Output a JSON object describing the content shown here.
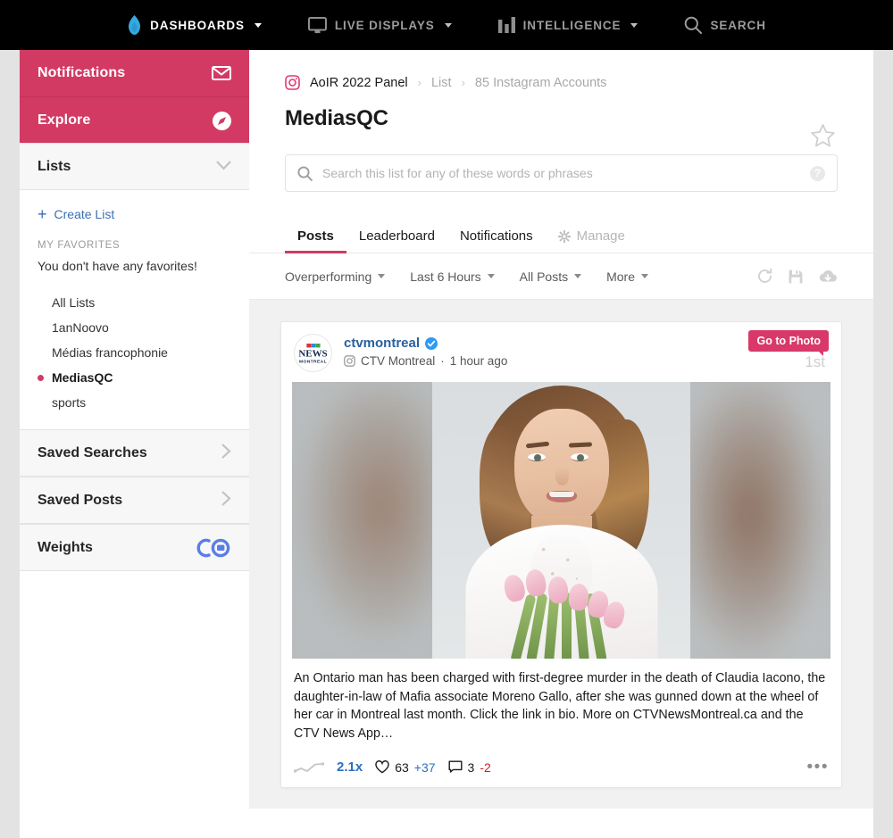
{
  "topnav": {
    "items": [
      {
        "label": "DASHBOARDS",
        "icon": "flame-icon",
        "caret": true,
        "active": true
      },
      {
        "label": "LIVE DISPLAYS",
        "icon": "monitor-icon",
        "caret": true,
        "active": false
      },
      {
        "label": "INTELLIGENCE",
        "icon": "bar-chart-icon",
        "caret": true,
        "active": false
      },
      {
        "label": "SEARCH",
        "icon": "search-icon",
        "caret": false,
        "active": false
      }
    ]
  },
  "sidebar": {
    "notifications_label": "Notifications",
    "notifications_icon": "envelope-icon",
    "explore_label": "Explore",
    "explore_icon": "compass-icon",
    "lists_label": "Lists",
    "lists_chevron": "chevron-down-icon",
    "create_list_label": "Create List",
    "favorites_header": "MY FAVORITES",
    "favorites_empty": "You don't have any favorites!",
    "lists": [
      {
        "label": "All Lists",
        "selected": false
      },
      {
        "label": "1anNoovo",
        "selected": false
      },
      {
        "label": "Médias francophonie",
        "selected": false
      },
      {
        "label": "MediasQC",
        "selected": true
      },
      {
        "label": "sports",
        "selected": false
      }
    ],
    "saved_searches_label": "Saved Searches",
    "saved_posts_label": "Saved Posts",
    "weights_label": "Weights",
    "weights_icon": "crowdtangle-co-icon"
  },
  "header": {
    "platform_icon": "instagram-icon",
    "breadcrumb": [
      {
        "label": "AoIR 2022 Panel",
        "muted": false
      },
      {
        "label": "List",
        "muted": true
      },
      {
        "label": "85 Instagram Accounts",
        "muted": true
      }
    ],
    "star_icon": "star-outline-icon",
    "title": "MediasQC"
  },
  "search": {
    "icon": "search-icon",
    "value": "",
    "placeholder": "Search this list for any of these words or phrases",
    "help_icon": "question-mark-icon",
    "help_label": "?"
  },
  "tabs": [
    {
      "label": "Posts",
      "active": true,
      "muted": false
    },
    {
      "label": "Leaderboard",
      "active": false,
      "muted": false
    },
    {
      "label": "Notifications",
      "active": false,
      "muted": false
    },
    {
      "label": "Manage",
      "active": false,
      "muted": true,
      "icon": "gear-icon"
    }
  ],
  "filters": {
    "items": [
      {
        "label": "Overperforming"
      },
      {
        "label": "Last 6 Hours"
      },
      {
        "label": "All Posts"
      },
      {
        "label": "More"
      }
    ],
    "tools": [
      {
        "name": "refresh-icon"
      },
      {
        "name": "save-icon"
      },
      {
        "name": "download-cloud-icon"
      }
    ]
  },
  "post": {
    "avatar_name": "ctv-news-montreal-logo",
    "avatar_line1": "CTV",
    "avatar_line2": "NEWS",
    "avatar_line3": "MONTREAL",
    "handle": "ctvmontreal",
    "verified_icon": "verified-badge-icon",
    "source_icon": "instagram-icon",
    "source": "CTV Montreal",
    "separator": "·",
    "time": "1 hour ago",
    "goto_label": "Go to Photo",
    "rank": "1st",
    "image_alt": "Woman in white lace dress holding pink tulips",
    "text": "An Ontario man has been charged with first-degree murder in the death of Claudia Iacono, the daughter-in-law of Mafia associate Moreno Gallo, after she was gunned down at the wheel of her car in Montreal last month. Click the link in bio. More on CTVNewsMontreal.ca and the CTV News App…",
    "metrics": {
      "sparkline_icon": "sparkline-icon",
      "overperforming": "2.1x",
      "like_icon": "heart-icon",
      "likes": "63",
      "likes_delta": "+37",
      "comment_icon": "comment-icon",
      "comments": "3",
      "comments_delta": "-2",
      "more_icon": "ellipsis-icon"
    }
  },
  "colors": {
    "brand_pink": "#d23a64",
    "badge_pink": "#d8386a",
    "link_blue": "#2b5f9e",
    "accent_blue": "#2b6fc2",
    "negative_red": "#d11d1d",
    "nav_black": "#000000",
    "flame_blue": "#36a9e1"
  }
}
